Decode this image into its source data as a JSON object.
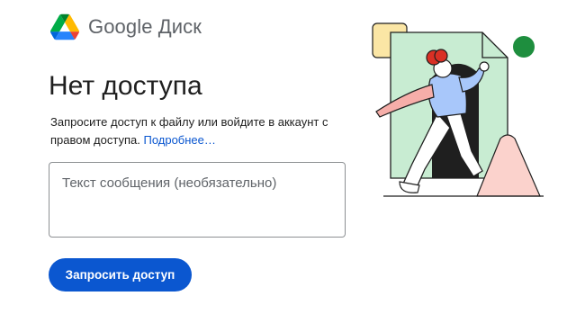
{
  "brand": {
    "name": "Google Диск",
    "logo_icon": "google-drive-logo",
    "colors": {
      "blue": "#4285f4",
      "green": "#0f9d58",
      "yellow": "#f4b400",
      "red": "#ea4335"
    }
  },
  "main": {
    "heading": "Нет доступа",
    "description": "Запросите доступ к файлу или войдите в аккаунт с правом доступа.",
    "learn_more_link": "Подробнее…",
    "message_placeholder": "Текст сообщения (необязательно)",
    "request_button": "Запросить доступ"
  },
  "theme": {
    "accent": "#0b57d0",
    "link": "#0b57d0",
    "text": "#1f1f1f",
    "muted": "#5f6368",
    "border": "#8d9093"
  },
  "illustration": {
    "icon": "locked-out-person-illustration",
    "colors": {
      "document": "#c8ecd2",
      "square": "#fbe6a5",
      "circle": "#1e8e3e",
      "triangle": "#fbd2cc",
      "shirt": "#a8c7fa",
      "hair": "#d93025",
      "arm": "#f6aea9"
    }
  }
}
